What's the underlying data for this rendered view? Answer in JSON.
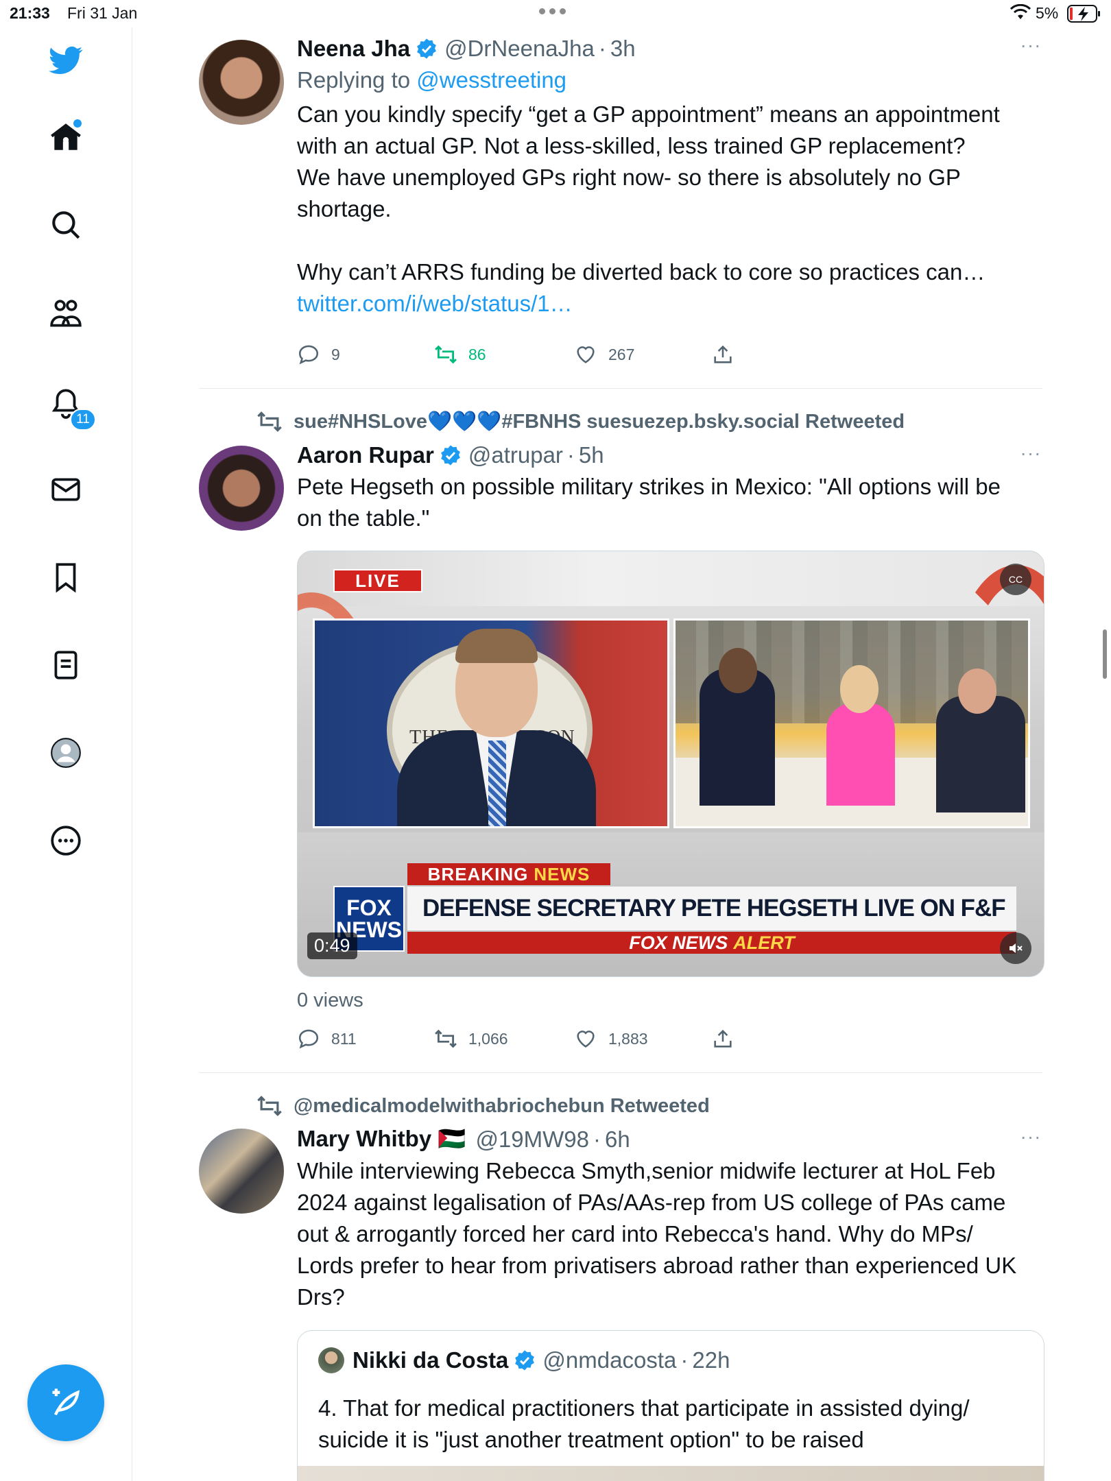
{
  "status_bar": {
    "time": "21:33",
    "date": "Fri 31 Jan",
    "battery": "5%"
  },
  "sidebar": {
    "notifications_badge": "11"
  },
  "tweets": [
    {
      "name": "Neena Jha",
      "handle": "@DrNeenaJha",
      "time": "3h",
      "replying_prefix": "Replying to ",
      "replying_to": "@wesstreeting",
      "text_lines": [
        "Can you kindly specify “get a GP appointment” means an appointment",
        "with an actual GP. Not a less-skilled, less trained GP replacement?",
        "We have unemployed GPs right now- so there is absolutely no GP",
        "shortage.",
        "",
        "Why can’t ARRS funding be diverted back to core so practices can…"
      ],
      "link": "twitter.com/i/web/status/1…",
      "replies": "9",
      "retweets": "86",
      "likes": "267"
    },
    {
      "retweeted_by": "sue#NHSLove💙💙💙#FBNHS suesuezep.bsky.social Retweeted",
      "name": "Aaron Rupar",
      "handle": "@atrupar",
      "time": "5h",
      "text_lines": [
        "Pete Hegseth on possible military strikes in Mexico: \"All options will be",
        "on the table.\""
      ],
      "video": {
        "live": "LIVE",
        "cc": "CC",
        "seal_left": "THE",
        "seal_right": "GON",
        "breaking": "BREAKING",
        "news": "NEWS",
        "headline": "DEFENSE SECRETARY PETE HEGSETH LIVE ON F&F",
        "alert_fox": "FOX NEWS",
        "alert_word": "ALERT",
        "logo_line1": "FOX",
        "logo_line2": "NEWS",
        "duration": "0:49"
      },
      "views": "0 views",
      "replies": "811",
      "retweets": "1,066",
      "likes": "1,883"
    },
    {
      "retweeted_by": "@medicalmodelwithabriochebun Retweeted",
      "name": "Mary Whitby 🇵🇸",
      "handle": "@19MW98",
      "time": "6h",
      "text_lines": [
        "While interviewing Rebecca Smyth,senior midwife lecturer at HoL Feb",
        "2024 against legalisation of PAs/AAs-rep from US college of PAs came",
        "out & arrogantly forced her card into Rebecca's hand. Why do MPs/",
        "Lords prefer to hear from privatisers abroad rather than experienced UK",
        "Drs?"
      ],
      "quote": {
        "name": "Nikki da Costa",
        "handle": "@nmdacosta",
        "time": "22h",
        "text_lines": [
          "4. That for medical practitioners that participate in assisted dying/",
          "suicide it is \"just another treatment option\" to be raised"
        ]
      }
    }
  ],
  "colors": {
    "accent": "#1d9bf0",
    "retweet_active": "#00ba7c",
    "muted": "#536471"
  }
}
